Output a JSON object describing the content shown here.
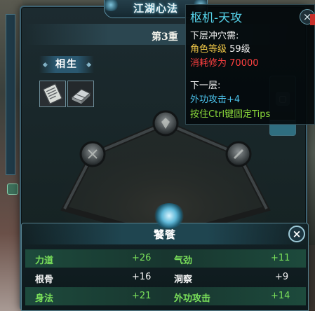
{
  "window": {
    "title": "江湖心法",
    "layer_label": "第3重",
    "section_label": "相生"
  },
  "tooltip": {
    "title": "枢机-天攻",
    "close_symbol": "×",
    "requirement_header": "下层冲穴需:",
    "req_level_label": "角色等级",
    "req_level_value": "59级",
    "req_cost_label": "消耗修为",
    "req_cost_value": "70000",
    "next_header": "下一层:",
    "next_bonus": "外功攻击+4",
    "hint": "按住Ctrl键固定Tips"
  },
  "stats_panel": {
    "title": "饕餮",
    "close_symbol": "×",
    "rows": [
      {
        "left_label": "力道",
        "left_value": "+26",
        "right_label": "气劲",
        "right_value": "+11"
      },
      {
        "left_label": "根骨",
        "left_value": "+16",
        "right_label": "洞察",
        "right_value": "+9"
      },
      {
        "left_label": "身法",
        "left_value": "+21",
        "right_label": "外功攻击",
        "right_value": "+14"
      }
    ]
  },
  "colors": {
    "tooltip_title": "#56d3ea",
    "requirement_gold": "#f0c848",
    "requirement_red": "#ff4040",
    "bonus_cyan": "#4cc3ec",
    "hint_green": "#8ad83a",
    "stat_green": "#7ae05a"
  },
  "icons": {
    "skill_1": "scroll-book-icon",
    "skill_2": "manual-book-icon",
    "nodes": "acupoint-node-icon"
  }
}
